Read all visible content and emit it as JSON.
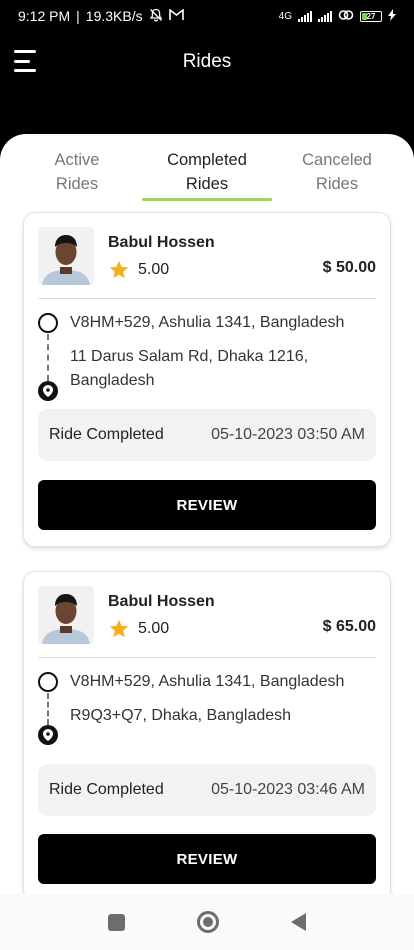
{
  "status_bar": {
    "time": "9:12 PM",
    "separator": "|",
    "speed": "19.3KB/s",
    "network": "4G",
    "battery": "27"
  },
  "app_bar": {
    "title": "Rides"
  },
  "tabs": [
    {
      "label_line1": "Active",
      "label_line2": "Rides",
      "active": false
    },
    {
      "label_line1": "Completed",
      "label_line2": "Rides",
      "active": true
    },
    {
      "label_line1": "Canceled",
      "label_line2": "Rides",
      "active": false
    }
  ],
  "rides": [
    {
      "driver_name": "Babul Hossen",
      "rating": "5.00",
      "price": "$ 50.00",
      "pickup": "V8HM+529, Ashulia 1341, Bangladesh",
      "dropoff_line1": "11 Darus Salam Rd, Dhaka 1216,",
      "dropoff_line2": "Bangladesh",
      "status": "Ride Completed",
      "datetime": "05-10-2023 03:50 AM",
      "action": "REVIEW"
    },
    {
      "driver_name": "Babul Hossen",
      "rating": "5.00",
      "price": "$ 65.00",
      "pickup": "V8HM+529, Ashulia 1341, Bangladesh",
      "dropoff_line1": "R9Q3+Q7, Dhaka, Bangladesh",
      "status": "Ride Completed",
      "datetime": "05-10-2023 03:46 AM",
      "action": "REVIEW"
    }
  ],
  "colors": {
    "accent": "#9ad84c",
    "star": "#f2b01e",
    "button": "#000000"
  },
  "icons": [
    "menu-icon",
    "star-icon",
    "origin-ring-icon",
    "location-pin-icon",
    "nav-recents-icon",
    "nav-home-icon",
    "nav-back-icon"
  ]
}
